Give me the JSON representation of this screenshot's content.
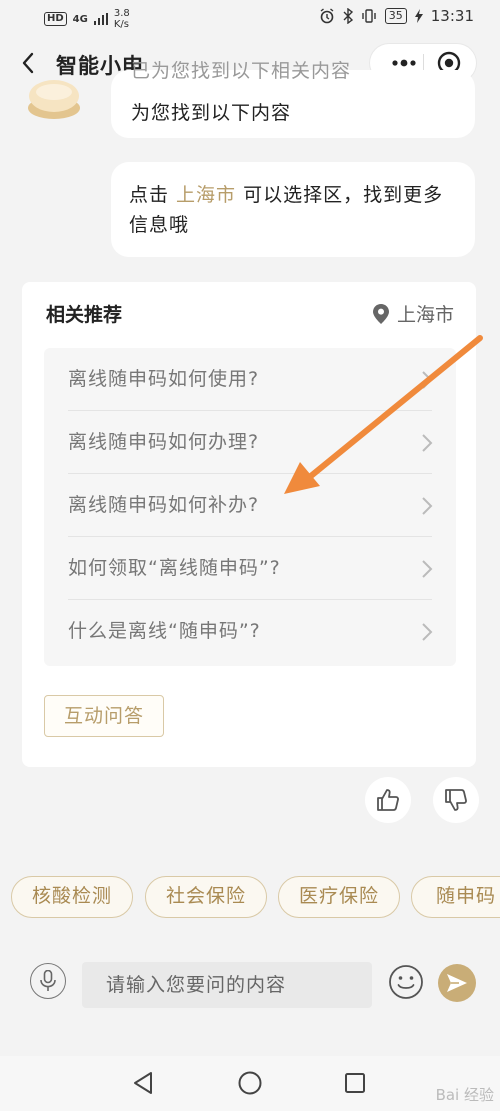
{
  "status_bar": {
    "hd": "HD",
    "network": "4G",
    "speed_value": "3.8",
    "speed_unit": "K/s",
    "battery": "35",
    "time": "13:31"
  },
  "header": {
    "title": "智能小申"
  },
  "messages": [
    {
      "partial_text": "已为您找到以下相关内容",
      "text": "为您找到以下内容"
    },
    {
      "prefix": "点击 ",
      "link": "上海市",
      "suffix": " 可以选择区，找到更多信息哦"
    }
  ],
  "recommend": {
    "title": "相关推荐",
    "location": "上海市",
    "items": [
      "离线随申码如何使用?",
      "离线随申码如何办理?",
      "离线随申码如何补办?",
      "如何领取“离线随申码”?",
      "什么是离线“随申码”?"
    ],
    "qa_button": "互动问答"
  },
  "chips": [
    "核酸检测",
    "社会保险",
    "医疗保险",
    "随申码"
  ],
  "input": {
    "placeholder": "请输入您要问的内容"
  },
  "watermark": "Bai 经验",
  "colors": {
    "accent": "#b79d6a",
    "chip_text": "#a98a52",
    "annotation_arrow": "#f08a3c"
  }
}
